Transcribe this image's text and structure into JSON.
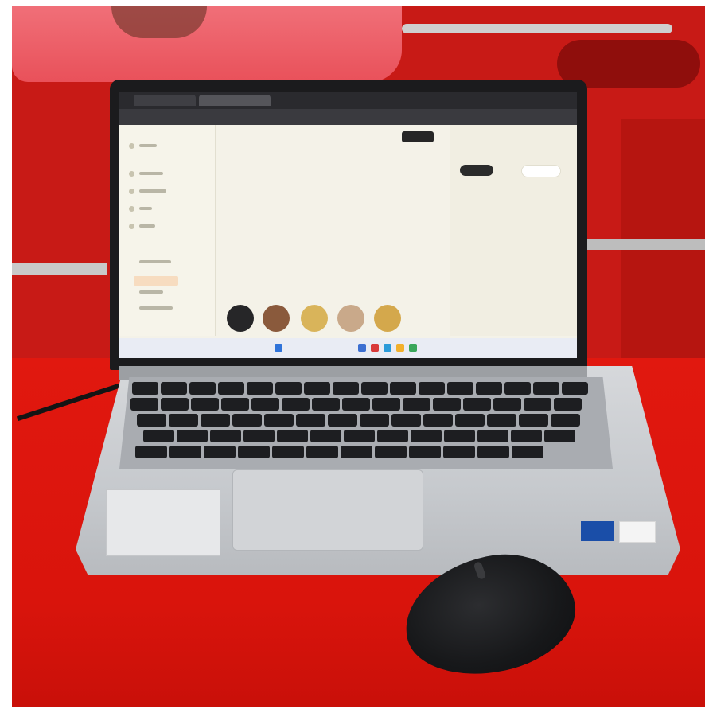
{
  "scene": {
    "subject": "laptop",
    "colors": {
      "wall": "#c81a16",
      "table": "#e1180f",
      "laptop_body": "#c6c9cd",
      "screen_bg": "#f4f2e8",
      "mouse": "#17181a",
      "accent_button": "#f4c98f"
    }
  },
  "icons": {
    "browser_tab": "tab-icon",
    "sidebar": "dot-icon",
    "taskbar": "app-icon",
    "sticker": "dell-logo-icon",
    "badge": "intel-icon"
  }
}
